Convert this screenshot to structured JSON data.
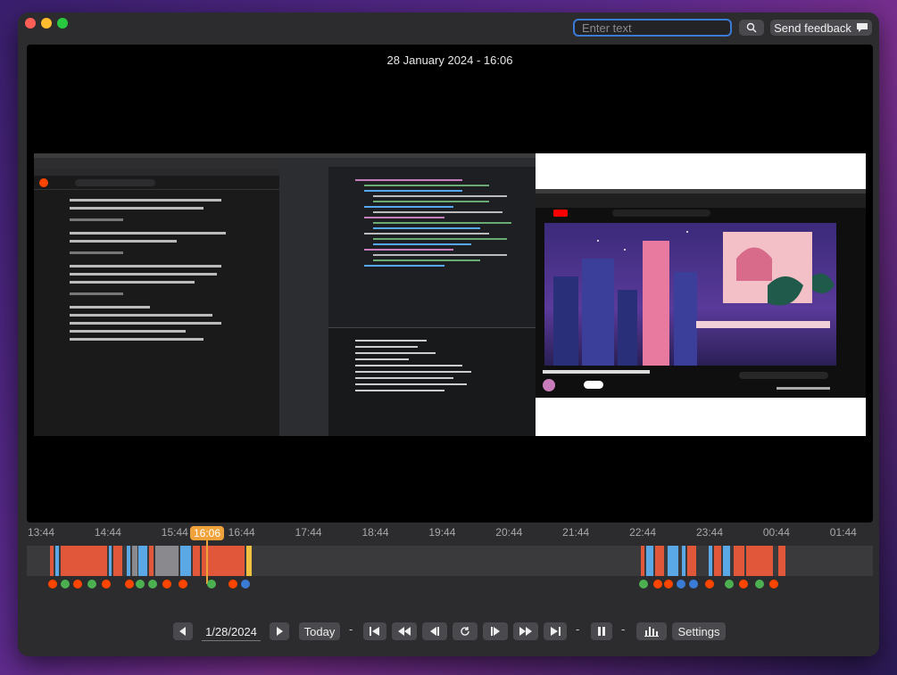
{
  "search": {
    "placeholder": "Enter text"
  },
  "header": {
    "feedback_label": "Send feedback"
  },
  "viewer": {
    "datetime": "28 January 2024 - 16:06"
  },
  "timeline": {
    "labels": [
      "13:44",
      "14:44",
      "15:44",
      "16:44",
      "17:44",
      "18:44",
      "19:44",
      "20:44",
      "21:44",
      "22:44",
      "23:44",
      "00:44",
      "01:44"
    ],
    "current": "16:06"
  },
  "controls": {
    "date": "1/28/2024",
    "today_label": "Today",
    "settings_label": "Settings"
  },
  "colors": {
    "accent": "#f0a23a",
    "focus_ring": "#3a7bd5",
    "activity_red": "#e0573a",
    "activity_blue": "#5aa9e6",
    "activity_gray": "#8a8a8e",
    "activity_yellow": "#f0c040"
  },
  "screens": {
    "left": "reddit-browser-screenshot",
    "middle": "code-editor-screenshot",
    "right": "youtube-video-screenshot"
  }
}
